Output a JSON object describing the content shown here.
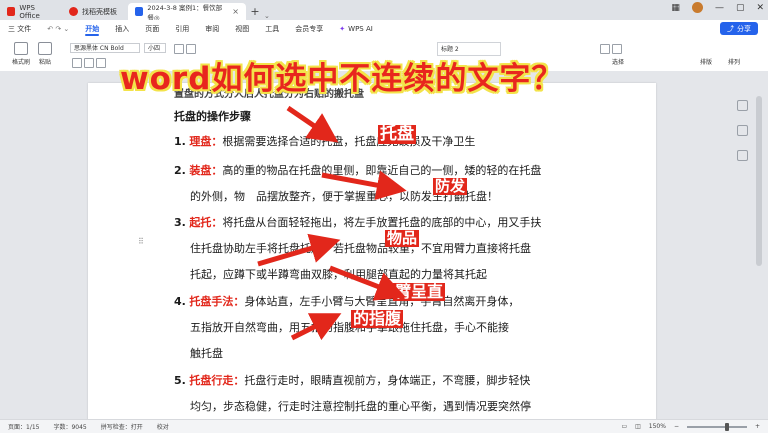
{
  "tabs": {
    "home": "WPS Office",
    "template": "找稻壳模板",
    "document": "2024-3-8 案例1：餐饮部餐◎"
  },
  "window": {
    "min": "—",
    "max": "▢",
    "close": "✕"
  },
  "menu": {
    "file": "三 文件",
    "items": [
      "开始",
      "插入",
      "页面",
      "引用",
      "审阅",
      "视图",
      "工具",
      "会员专享"
    ],
    "ai": "WPS AI",
    "share": "分享"
  },
  "ribbon": {
    "format_painter": "格式刷",
    "paste": "粘贴",
    "font_name": "思源黑体 CN Bold",
    "font_size": "小四",
    "style_sample": "标题 2",
    "select": "选择",
    "arrange": "排版",
    "sort": "排列"
  },
  "overlay_title": "word如何选中不连续的文字？",
  "doc": {
    "cut_line": "置盘的方式分人后人托盘分为右贴的搬托盘",
    "heading": "托盘的操作步骤",
    "items": [
      {
        "num": "1.",
        "key": "理盘：",
        "lines": [
          "根据需要选择合适的托盘，托盘应无破损及干净卫生"
        ]
      },
      {
        "num": "2.",
        "key": "装盘：",
        "lines": [
          "高的重的物品在托盘的里侧，即靠近自己的一侧，矮的轻的在托盘",
          "的外侧，物　品摆放整齐，便于掌握重心，以防发生打翻托盘！"
        ]
      },
      {
        "num": "3.",
        "key": "起托：",
        "lines": [
          "将托盘从台面轻轻拖出，将左手放置托盘的底部的中心，用又手扶",
          "住托盘协助左手将托盘托起，若托盘物品较重，不宜用臂力直接将托盘",
          "托起，应蹲下或半蹲弯曲双膝，利用腿部直起的力量将其托起"
        ]
      },
      {
        "num": "4.",
        "key": "托盘手法：",
        "lines": [
          "身体站直，左手小臂与大臂呈直角，手臂自然离开身体，",
          "五指放开自然弯曲，用五指的指腹和手掌跟拖住托盘，手心不能接",
          "触托盘"
        ]
      },
      {
        "num": "5.",
        "key": "托盘行走：",
        "lines": [
          "托盘行走时，眼睛直视前方，身体端正，不弯腰，脚步轻快",
          "均匀，步态稳健，行走时注意控制托盘的重心平衡，遇到情况要突然停"
        ]
      }
    ],
    "highlights": [
      "托盘",
      "防发",
      "物品",
      "臂呈直",
      "的指腹"
    ]
  },
  "status": {
    "page": "页面：1/15",
    "words": "字数：9045",
    "spell": "拼写检查：打开",
    "proof": "校对",
    "zoom": "150%"
  },
  "colors": {
    "accent": "#2563eb",
    "highlight": "#e2271b",
    "title_outline": "#f3e34a"
  }
}
